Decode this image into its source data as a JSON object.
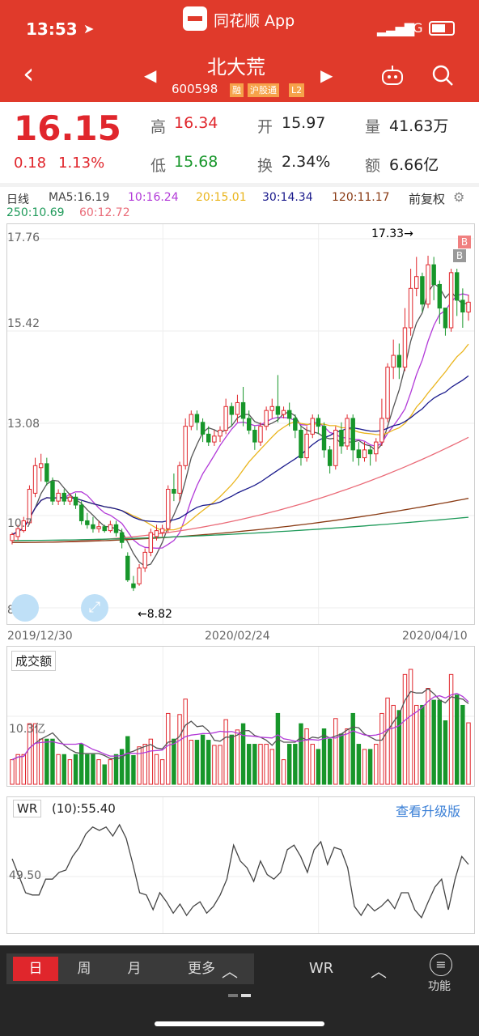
{
  "status": {
    "time": "13:53",
    "app": "同花顺 App",
    "network": "4G"
  },
  "nav": {
    "title": "北大荒",
    "code": "600598",
    "tags": [
      "融",
      "沪股通",
      "L2"
    ]
  },
  "quote": {
    "price": "16.15",
    "change": "0.18",
    "change_pct": "1.13%",
    "high_label": "高",
    "high": "16.34",
    "open_label": "开",
    "open": "15.97",
    "vol_label": "量",
    "vol": "41.63万",
    "low_label": "低",
    "low": "15.68",
    "turn_label": "换",
    "turn": "2.34%",
    "amt_label": "额",
    "amt": "6.66亿"
  },
  "ma_legend": {
    "period": "日线",
    "ma5": "MA5:16.19",
    "ma10": "10:16.24",
    "ma20": "20:15.01",
    "ma30": "30:14.34",
    "ma120": "120:11.17",
    "ma250": "250:10.69",
    "ma60": "60:12.72",
    "adjust": "前复权"
  },
  "colors": {
    "ma5": "#555555",
    "ma10": "#b23ad8",
    "ma20": "#eab51d",
    "ma30": "#1a1a8c",
    "ma120": "#8a3b14",
    "ma250": "#1f9a5a",
    "ma60": "#ea6b78",
    "up": "#e0262c",
    "down": "#17962a"
  },
  "kline": {
    "y_ticks": [
      "17.76",
      "15.42",
      "13.08",
      "10.7",
      "8.39"
    ],
    "x_dates": [
      "2019/12/30",
      "2020/02/24",
      "2020/04/10"
    ],
    "max_marker": "17.33→",
    "min_marker": "←8.82"
  },
  "candles": [
    [
      10.1,
      10.25,
      10.0,
      10.3
    ],
    [
      10.2,
      10.4,
      10.1,
      10.5
    ],
    [
      10.35,
      10.6,
      10.3,
      10.7
    ],
    [
      10.55,
      11.4,
      10.5,
      11.5
    ],
    [
      11.3,
      12.0,
      11.2,
      12.2
    ],
    [
      11.95,
      12.05,
      11.6,
      12.3
    ],
    [
      12.05,
      11.6,
      11.5,
      12.2
    ],
    [
      11.6,
      11.1,
      11.0,
      11.7
    ],
    [
      11.1,
      11.3,
      11.0,
      11.4
    ],
    [
      11.3,
      11.1,
      11.0,
      11.4
    ],
    [
      11.1,
      11.2,
      11.0,
      11.3
    ],
    [
      11.2,
      11.0,
      10.9,
      11.3
    ],
    [
      11.0,
      10.6,
      10.5,
      11.1
    ],
    [
      10.6,
      10.5,
      10.4,
      10.8
    ],
    [
      10.5,
      10.4,
      10.3,
      10.7
    ],
    [
      10.4,
      10.45,
      10.3,
      10.6
    ],
    [
      10.45,
      10.35,
      10.3,
      10.5
    ],
    [
      10.35,
      10.5,
      10.3,
      10.6
    ],
    [
      10.5,
      10.3,
      10.2,
      10.6
    ],
    [
      10.3,
      10.05,
      9.9,
      10.4
    ],
    [
      9.7,
      9.1,
      9.05,
      9.8
    ],
    [
      9.0,
      8.9,
      8.82,
      9.2
    ],
    [
      9.0,
      9.4,
      8.95,
      9.5
    ],
    [
      9.4,
      9.8,
      9.3,
      9.9
    ],
    [
      9.8,
      10.3,
      9.7,
      10.4
    ],
    [
      10.2,
      10.35,
      10.1,
      10.5
    ],
    [
      10.3,
      10.4,
      10.2,
      10.5
    ],
    [
      10.4,
      11.4,
      10.3,
      11.5
    ],
    [
      11.4,
      11.3,
      11.1,
      11.8
    ],
    [
      11.3,
      12.0,
      11.1,
      12.1
    ],
    [
      12.0,
      13.0,
      11.9,
      13.2
    ],
    [
      13.0,
      13.3,
      12.9,
      13.4
    ],
    [
      13.3,
      13.1,
      12.9,
      13.4
    ],
    [
      13.1,
      12.8,
      12.6,
      13.2
    ],
    [
      12.8,
      12.6,
      12.5,
      13.0
    ],
    [
      12.6,
      12.75,
      12.5,
      12.9
    ],
    [
      12.75,
      12.9,
      12.6,
      13.0
    ],
    [
      12.9,
      13.5,
      12.8,
      13.7
    ],
    [
      13.5,
      13.3,
      13.0,
      13.6
    ],
    [
      13.3,
      13.6,
      13.1,
      13.8
    ],
    [
      13.6,
      13.2,
      13.0,
      14.0
    ],
    [
      13.2,
      12.9,
      12.8,
      13.4
    ],
    [
      12.9,
      12.6,
      12.4,
      13.0
    ],
    [
      12.6,
      13.0,
      12.5,
      13.1
    ],
    [
      13.0,
      13.4,
      12.9,
      13.5
    ],
    [
      13.4,
      13.5,
      13.2,
      13.7
    ],
    [
      13.5,
      13.3,
      13.1,
      14.3
    ],
    [
      13.3,
      13.4,
      13.2,
      13.5
    ],
    [
      13.4,
      13.2,
      13.0,
      13.6
    ],
    [
      13.2,
      12.9,
      12.7,
      13.3
    ],
    [
      12.9,
      12.2,
      12.0,
      13.0
    ],
    [
      12.2,
      12.8,
      12.1,
      13.0
    ],
    [
      12.8,
      13.2,
      12.7,
      13.3
    ],
    [
      13.2,
      13.0,
      12.8,
      13.3
    ],
    [
      13.0,
      12.4,
      12.2,
      13.1
    ],
    [
      12.4,
      12.0,
      11.8,
      12.5
    ],
    [
      12.0,
      12.9,
      11.9,
      13.0
    ],
    [
      12.9,
      12.5,
      12.3,
      13.1
    ],
    [
      12.5,
      13.2,
      12.4,
      13.3
    ],
    [
      13.2,
      12.4,
      12.1,
      13.3
    ],
    [
      12.4,
      12.2,
      12.0,
      12.6
    ],
    [
      12.2,
      12.4,
      12.1,
      12.6
    ],
    [
      12.4,
      12.3,
      12.0,
      12.5
    ],
    [
      12.3,
      12.6,
      12.1,
      12.7
    ],
    [
      12.6,
      13.2,
      12.5,
      13.7
    ],
    [
      13.2,
      14.5,
      13.1,
      14.6
    ],
    [
      14.5,
      14.8,
      14.2,
      15.2
    ],
    [
      14.8,
      14.5,
      14.2,
      15.1
    ],
    [
      14.5,
      15.5,
      14.4,
      16.0
    ],
    [
      15.5,
      16.5,
      15.3,
      17.0
    ],
    [
      16.5,
      16.8,
      16.3,
      17.3
    ],
    [
      16.8,
      16.1,
      15.9,
      16.9
    ],
    [
      16.1,
      17.1,
      16.0,
      17.33
    ],
    [
      17.1,
      16.6,
      16.2,
      17.3
    ],
    [
      16.6,
      16.0,
      15.6,
      16.7
    ],
    [
      16.0,
      15.5,
      15.3,
      16.0
    ],
    [
      15.5,
      16.9,
      15.4,
      17.0
    ],
    [
      16.9,
      16.2,
      15.8,
      17.0
    ],
    [
      16.2,
      15.9,
      15.5,
      16.5
    ],
    [
      15.9,
      16.15,
      15.68,
      16.34
    ]
  ],
  "volume": {
    "label": "成交额",
    "y_tick": "10.3亿"
  },
  "wr": {
    "label": "WR",
    "value": "(10):55.40",
    "upgrade": "查看升级版",
    "y_tick": "49.50",
    "values": [
      60,
      45,
      30,
      28,
      28,
      42,
      42,
      48,
      50,
      62,
      70,
      82,
      88,
      85,
      88,
      80,
      90,
      78,
      55,
      30,
      28,
      15,
      30,
      22,
      12,
      20,
      10,
      18,
      22,
      12,
      18,
      28,
      42,
      72,
      58,
      52,
      40,
      58,
      46,
      42,
      48,
      68,
      72,
      62,
      48,
      68,
      75,
      55,
      70,
      68,
      52,
      18,
      10,
      20,
      14,
      18,
      24,
      16,
      30,
      30,
      15,
      8,
      22,
      35,
      42,
      15,
      42,
      62,
      55
    ]
  },
  "bottom_tabs": {
    "day": "日",
    "week": "周",
    "month": "月",
    "more": "更多",
    "wr": "WR",
    "func": "功能"
  }
}
